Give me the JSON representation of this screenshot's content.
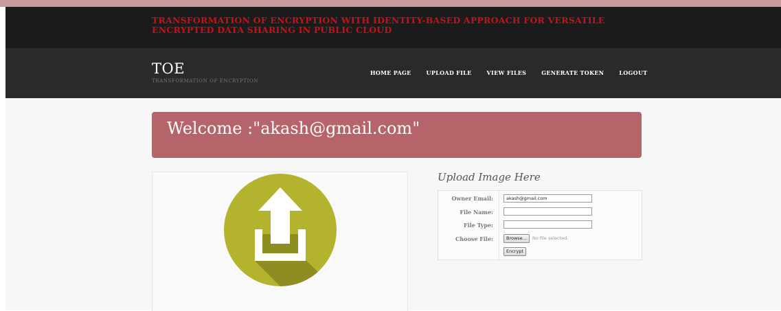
{
  "header": {
    "banner_title": "TRANSFORMATION OF ENCRYPTION WITH IDENTITY-BASED APPROACH FOR VERSATILE ENCRYPTED DATA SHARING IN PUBLIC CLOUD",
    "brand": "TOE",
    "brand_subtitle": "TRANSFORMATION OF ENCRYPTION"
  },
  "nav": {
    "items": [
      {
        "label": "HOME PAGE"
      },
      {
        "label": "UPLOAD FILE"
      },
      {
        "label": "VIEW FILES"
      },
      {
        "label": "GENERATE TOKEN"
      },
      {
        "label": "LOGOUT"
      }
    ]
  },
  "welcome": {
    "text": "Welcome :\"akash@gmail.com\""
  },
  "upload": {
    "title": "Upload Image Here",
    "icon": "upload-icon",
    "fields": {
      "owner_email_label": "Owner Email:",
      "owner_email_value": "akash@gmail.com",
      "file_name_label": "File Name:",
      "file_name_value": "",
      "file_type_label": "File Type:",
      "file_type_value": "",
      "choose_file_label": "Choose File:",
      "browse_label": "Browse...",
      "no_file_text": "No file selected.",
      "encrypt_label": "Encrypt"
    }
  },
  "colors": {
    "banner_bg": "#1b1b1b",
    "banner_title": "#c4121a",
    "navbar_bg": "#2a2a2a",
    "welcome_bg": "#b5646a",
    "icon_circle": "#b3b32e",
    "icon_shadow": "#8d8d22"
  }
}
